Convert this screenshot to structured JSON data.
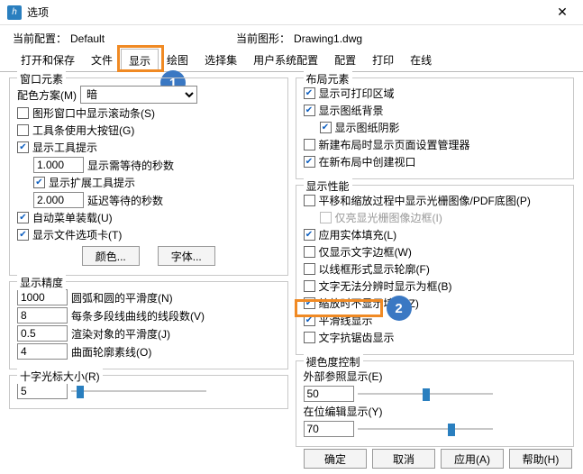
{
  "title": "选项",
  "toprow": {
    "cfg_lbl": "当前配置：",
    "cfg_val": "Default",
    "dwg_lbl": "当前图形：",
    "dwg_val": "Drawing1.dwg"
  },
  "tabs": [
    "打开和保存",
    "文件",
    "显示",
    "绘图",
    "选择集",
    "用户系统配置",
    "配置",
    "打印",
    "在线"
  ],
  "window_elem": {
    "title": "窗口元素",
    "scheme_lbl": "配色方案(M)",
    "scheme_val": "暗",
    "c_scroll": "图形窗口中显示滚动条(S)",
    "c_bigbtn": "工具条使用大按钮(G)",
    "c_tooltip": "显示工具提示",
    "wait_val": "1.000",
    "wait_lbl": "显示需等待的秒数",
    "c_ext": "显示扩展工具提示",
    "delay_val": "2.000",
    "delay_lbl": "延迟等待的秒数",
    "c_autoload": "自动菜单装载(U)",
    "c_filetab": "显示文件选项卡(T)",
    "btn_color": "颜色...",
    "btn_font": "字体..."
  },
  "disp_acc": {
    "title": "显示精度",
    "v1": "1000",
    "l1": "圆弧和圆的平滑度(N)",
    "v2": "8",
    "l2": "每条多段线曲线的线段数(V)",
    "v3": "0.5",
    "l3": "渲染对象的平滑度(J)",
    "v4": "4",
    "l4": "曲面轮廓素线(O)"
  },
  "cross": {
    "lbl": "十字光标大小(R)",
    "val": "5"
  },
  "layout_elem": {
    "title": "布局元素",
    "c_prn": "显示可打印区域",
    "c_bg": "显示图纸背景",
    "c_shadow": "显示图纸阴影",
    "c_pgmgr": "新建布局时显示页面设置管理器",
    "c_vp": "在新布局中创建视口"
  },
  "disp_perf": {
    "title": "显示性能",
    "c_pan": "平移和缩放过程中显示光栅图像/PDF底图(P)",
    "c_raster": "仅亮显光栅图像边框(I)",
    "c_solid": "应用实体填充(L)",
    "c_txtframe": "仅显示文字边框(W)",
    "c_lwframe": "以线框形式显示轮廓(F)",
    "c_nores": "文字无法分辨时显示为框(B)",
    "c_zoomfill": "缩放时不显示填充(Z)",
    "c_smooth": "平滑线显示",
    "c_aa": "文字抗锯齿显示"
  },
  "fade": {
    "title": "褪色度控制",
    "l1": "外部参照显示(E)",
    "v1": "50",
    "l2": "在位编辑显示(Y)",
    "v2": "70"
  },
  "buttons": {
    "ok": "确定",
    "cancel": "取消",
    "apply": "应用(A)",
    "help": "帮助(H)"
  },
  "marks": {
    "a": "1",
    "b": "2"
  }
}
